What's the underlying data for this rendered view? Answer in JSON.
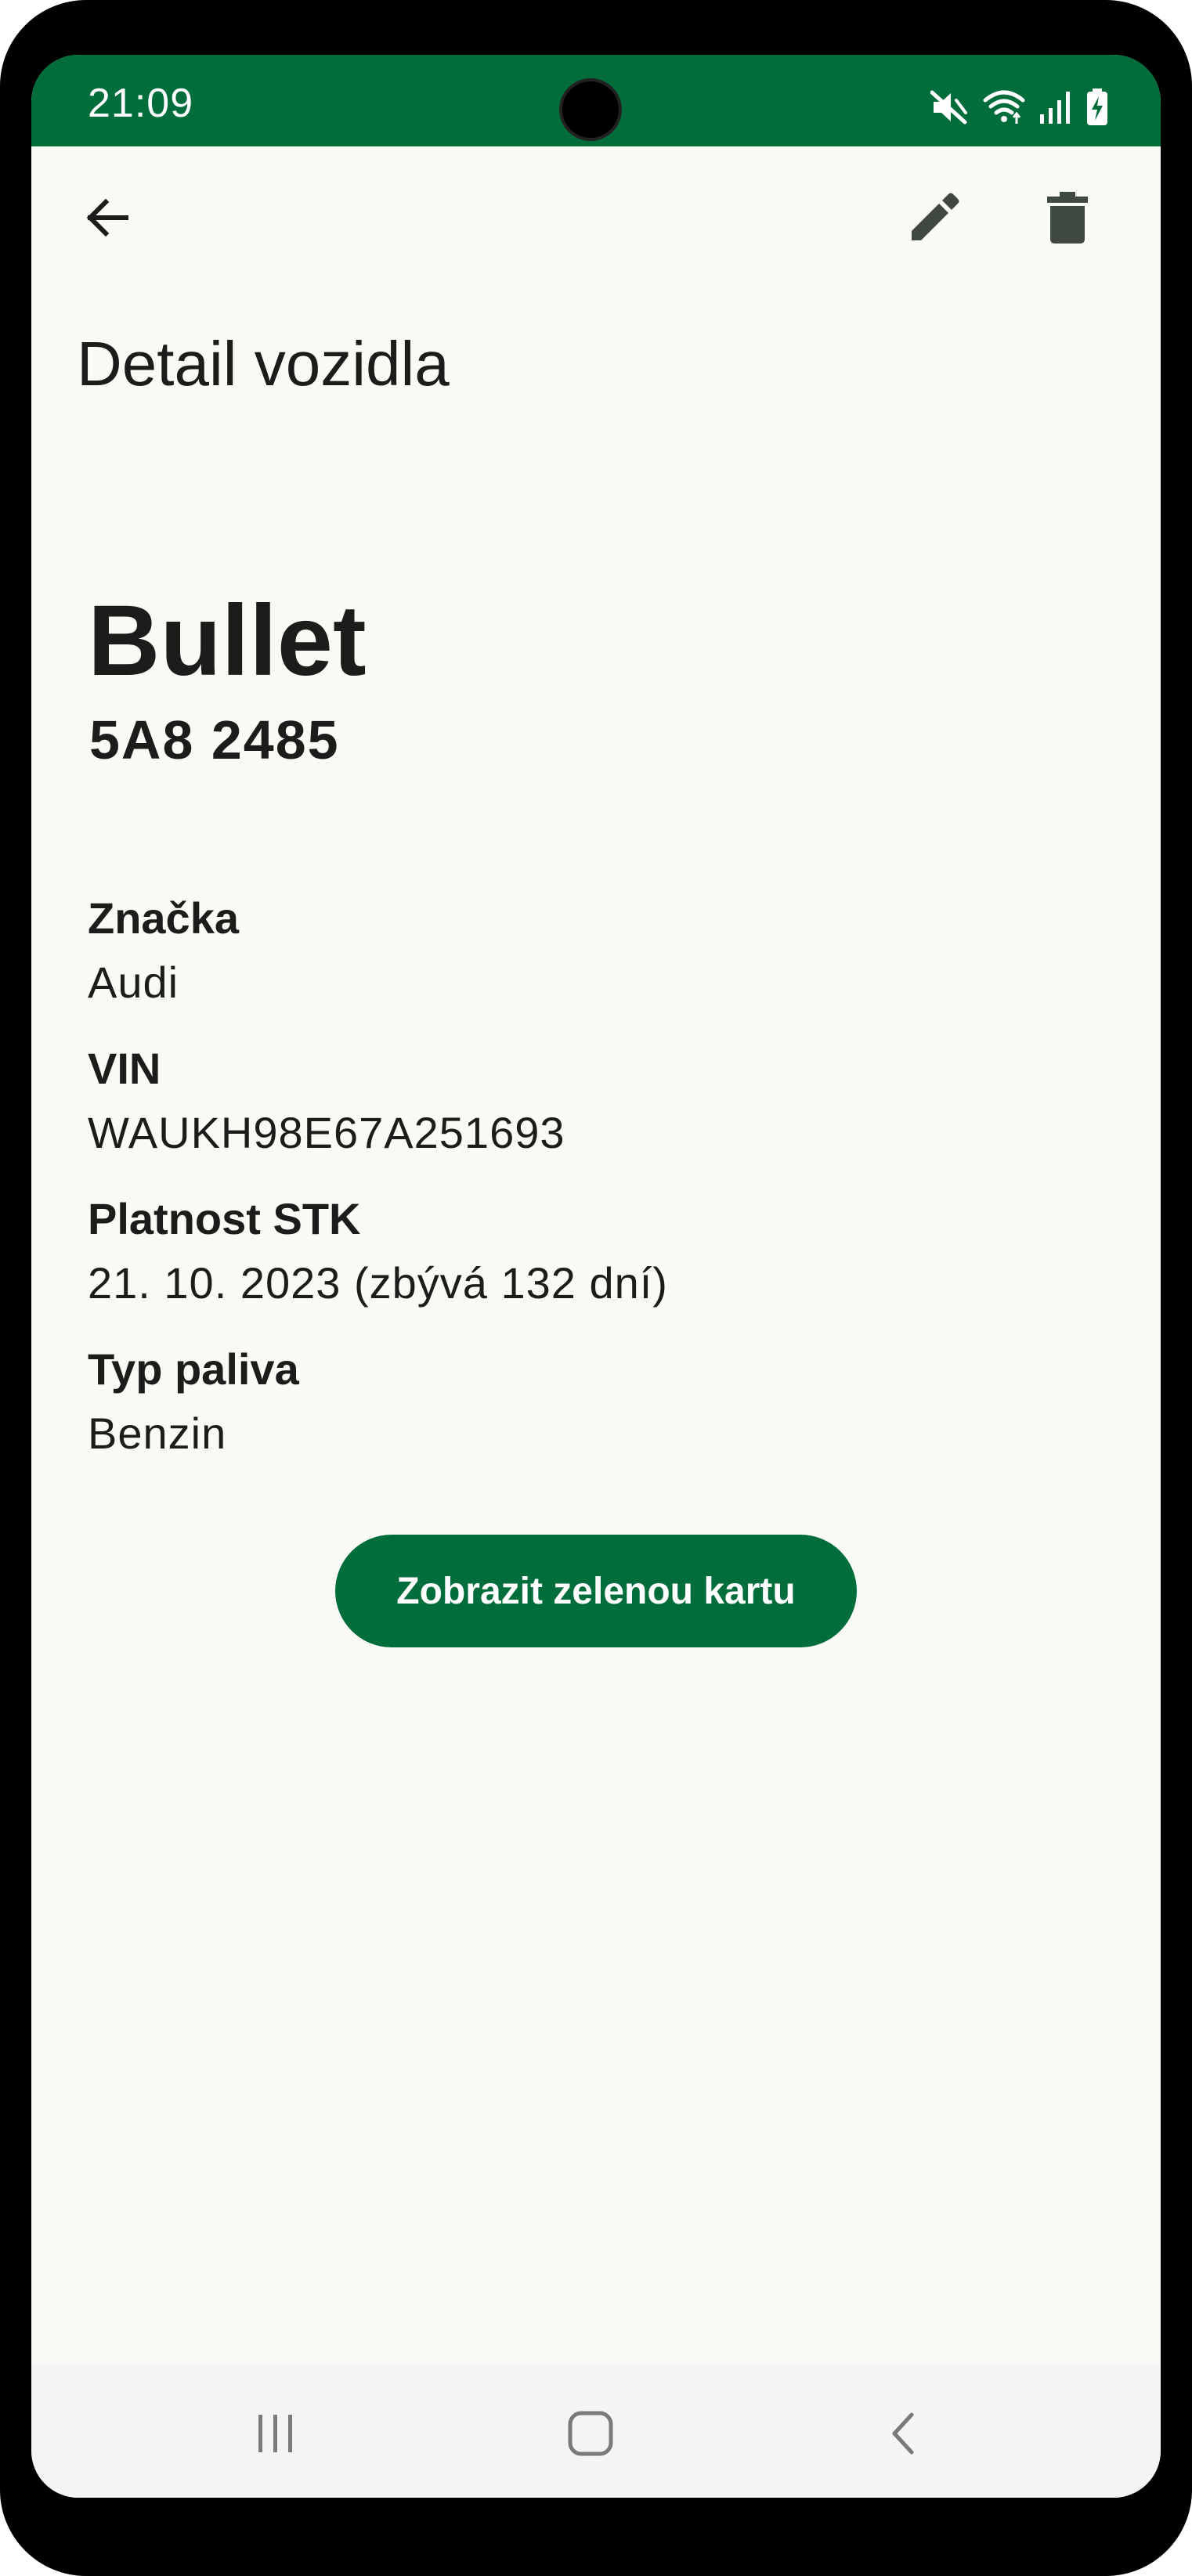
{
  "status_bar": {
    "time": "21:09",
    "icons": [
      "mute-icon",
      "wifi-icon",
      "signal-icon",
      "battery-charging-icon"
    ],
    "background": "#006d3b"
  },
  "app_bar": {
    "back_icon": "arrow-back-icon",
    "edit_icon": "pencil-icon",
    "delete_icon": "trash-icon"
  },
  "page": {
    "title": "Detail vozidla"
  },
  "vehicle": {
    "name": "Bullet",
    "plate": "5A8 2485"
  },
  "details": [
    {
      "label": "Značka",
      "value": "Audi"
    },
    {
      "label": "VIN",
      "value": "WAUKH98E67A251693"
    },
    {
      "label": "Platnost STK",
      "value": "21. 10. 2023 (zbývá 132 dní)"
    },
    {
      "label": "Typ paliva",
      "value": "Benzin"
    }
  ],
  "actions": {
    "green_card_label": "Zobrazit zelenou kartu"
  },
  "nav_bar": {
    "icons": [
      "recents-icon",
      "home-icon",
      "nav-back-icon"
    ]
  },
  "colors": {
    "accent": "#006d3b",
    "background": "#f9faf6",
    "text": "#1b1d1a"
  }
}
